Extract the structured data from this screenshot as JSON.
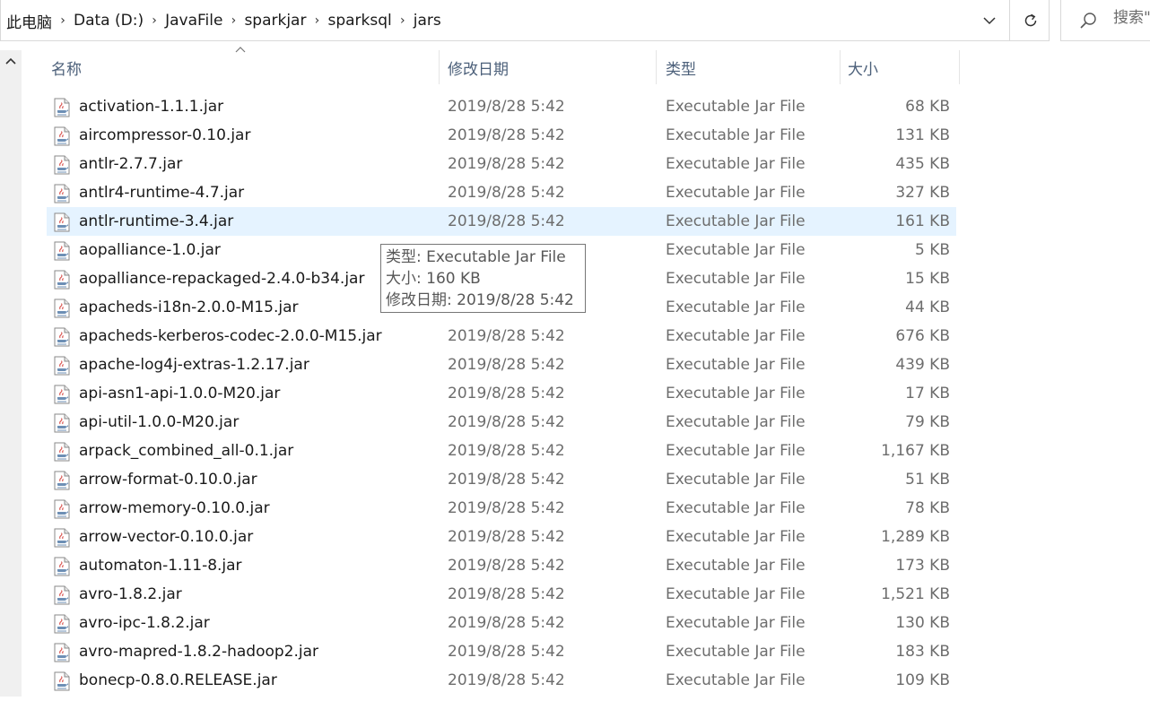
{
  "address_bar": {
    "crumbs": [
      "此电脑",
      "Data (D:)",
      "JavaFile",
      "sparkjar",
      "sparksql",
      "jars"
    ]
  },
  "search": {
    "placeholder": "搜索\""
  },
  "columns": {
    "name": "名称",
    "date": "修改日期",
    "type": "类型",
    "size": "大小"
  },
  "files": [
    {
      "name": "activation-1.1.1.jar",
      "date": "2019/8/28 5:42",
      "type": "Executable Jar File",
      "size": "68 KB"
    },
    {
      "name": "aircompressor-0.10.jar",
      "date": "2019/8/28 5:42",
      "type": "Executable Jar File",
      "size": "131 KB"
    },
    {
      "name": "antlr-2.7.7.jar",
      "date": "2019/8/28 5:42",
      "type": "Executable Jar File",
      "size": "435 KB"
    },
    {
      "name": "antlr4-runtime-4.7.jar",
      "date": "2019/8/28 5:42",
      "type": "Executable Jar File",
      "size": "327 KB"
    },
    {
      "name": "antlr-runtime-3.4.jar",
      "date": "2019/8/28 5:42",
      "type": "Executable Jar File",
      "size": "161 KB",
      "hover": true
    },
    {
      "name": "aopalliance-1.0.jar",
      "date": "",
      "type": "Executable Jar File",
      "size": "5 KB"
    },
    {
      "name": "aopalliance-repackaged-2.4.0-b34.jar",
      "date": "",
      "type": "Executable Jar File",
      "size": "15 KB"
    },
    {
      "name": "apacheds-i18n-2.0.0-M15.jar",
      "date": "",
      "type": "Executable Jar File",
      "size": "44 KB"
    },
    {
      "name": "apacheds-kerberos-codec-2.0.0-M15.jar",
      "date": "2019/8/28 5:42",
      "type": "Executable Jar File",
      "size": "676 KB"
    },
    {
      "name": "apache-log4j-extras-1.2.17.jar",
      "date": "2019/8/28 5:42",
      "type": "Executable Jar File",
      "size": "439 KB"
    },
    {
      "name": "api-asn1-api-1.0.0-M20.jar",
      "date": "2019/8/28 5:42",
      "type": "Executable Jar File",
      "size": "17 KB"
    },
    {
      "name": "api-util-1.0.0-M20.jar",
      "date": "2019/8/28 5:42",
      "type": "Executable Jar File",
      "size": "79 KB"
    },
    {
      "name": "arpack_combined_all-0.1.jar",
      "date": "2019/8/28 5:42",
      "type": "Executable Jar File",
      "size": "1,167 KB"
    },
    {
      "name": "arrow-format-0.10.0.jar",
      "date": "2019/8/28 5:42",
      "type": "Executable Jar File",
      "size": "51 KB"
    },
    {
      "name": "arrow-memory-0.10.0.jar",
      "date": "2019/8/28 5:42",
      "type": "Executable Jar File",
      "size": "78 KB"
    },
    {
      "name": "arrow-vector-0.10.0.jar",
      "date": "2019/8/28 5:42",
      "type": "Executable Jar File",
      "size": "1,289 KB"
    },
    {
      "name": "automaton-1.11-8.jar",
      "date": "2019/8/28 5:42",
      "type": "Executable Jar File",
      "size": "173 KB"
    },
    {
      "name": "avro-1.8.2.jar",
      "date": "2019/8/28 5:42",
      "type": "Executable Jar File",
      "size": "1,521 KB"
    },
    {
      "name": "avro-ipc-1.8.2.jar",
      "date": "2019/8/28 5:42",
      "type": "Executable Jar File",
      "size": "130 KB"
    },
    {
      "name": "avro-mapred-1.8.2-hadoop2.jar",
      "date": "2019/8/28 5:42",
      "type": "Executable Jar File",
      "size": "183 KB"
    },
    {
      "name": "bonecp-0.8.0.RELEASE.jar",
      "date": "2019/8/28 5:42",
      "type": "Executable Jar File",
      "size": "109 KB"
    }
  ],
  "tooltip": {
    "line1": "类型: Executable Jar File",
    "line2": "大小: 160 KB",
    "line3": "修改日期: 2019/8/28 5:42"
  },
  "colors": {
    "hover_row": "#e5f3ff",
    "header_text": "#4c607a",
    "secondary_text": "#6d6d6d"
  }
}
